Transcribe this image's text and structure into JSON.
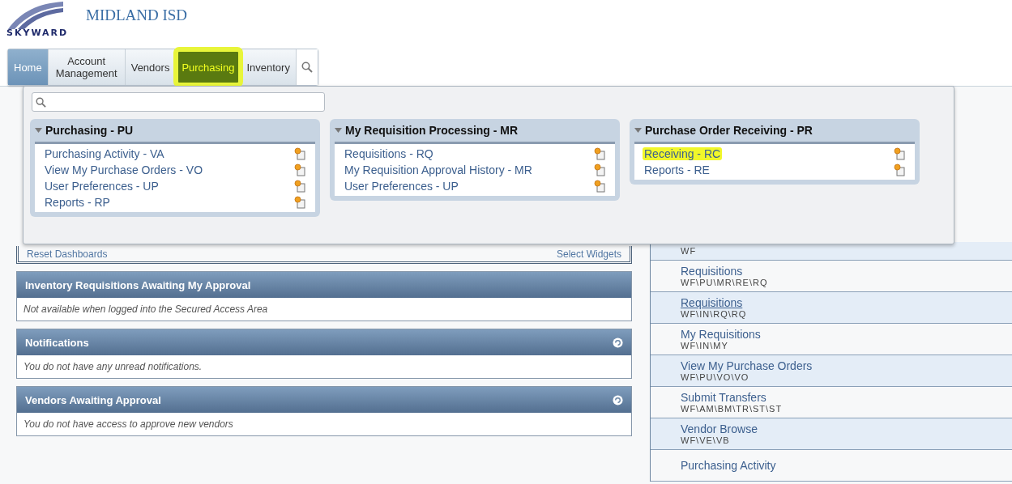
{
  "header": {
    "logo_text": "SKYWARD",
    "district": "MIDLAND ISD"
  },
  "tabs": [
    {
      "label": "Home",
      "selected": true,
      "highlighted": false
    },
    {
      "label": "Account Management",
      "selected": false,
      "highlighted": false
    },
    {
      "label": "Vendors",
      "selected": false,
      "highlighted": false
    },
    {
      "label": "Purchasing",
      "selected": false,
      "highlighted": true
    },
    {
      "label": "Inventory",
      "selected": false,
      "highlighted": false
    }
  ],
  "menu": {
    "groups": [
      {
        "title": "Purchasing - PU",
        "expanded": true,
        "items": [
          {
            "label": "Purchasing Activity - VA",
            "highlighted": false
          },
          {
            "label": "View My Purchase Orders - VO",
            "highlighted": false
          },
          {
            "label": "User Preferences - UP",
            "highlighted": false
          },
          {
            "label": "Reports - RP",
            "highlighted": false
          }
        ]
      },
      {
        "title": "My Requisition Processing - MR",
        "expanded": true,
        "items": [
          {
            "label": "Requisitions - RQ",
            "highlighted": false
          },
          {
            "label": "My Requisition Approval History - MR",
            "highlighted": false
          },
          {
            "label": "User Preferences - UP",
            "highlighted": false
          }
        ]
      },
      {
        "title": "Purchase Order Receiving - PR",
        "expanded": true,
        "items": [
          {
            "label": "Receiving - RC",
            "highlighted": true
          },
          {
            "label": "Reports - RE",
            "highlighted": false
          }
        ]
      }
    ]
  },
  "dashboard": {
    "left_link": "Reset Dashboards",
    "right_link": "Select Widgets"
  },
  "panels": [
    {
      "title": "Inventory Requisitions Awaiting My Approval",
      "message": "Not available when logged into the Secured Access Area",
      "refresh": false
    },
    {
      "title": "Notifications",
      "message": "You do not have any unread notifications.",
      "refresh": true
    },
    {
      "title": "Vendors Awaiting Approval",
      "message": "You do not have access to approve new vendors",
      "refresh": true
    }
  ],
  "shortcuts": [
    {
      "path": "WF",
      "hovered": false
    },
    {
      "title": "Requisitions",
      "path": "WF\\PU\\MR\\RE\\RQ",
      "hovered": false
    },
    {
      "title": "Requisitions",
      "path": "WF\\IN\\RQ\\RQ",
      "hovered": true
    },
    {
      "title": "My Requisitions",
      "path": "WF\\IN\\MY",
      "hovered": false
    },
    {
      "title": "View My Purchase Orders",
      "path": "WF\\PU\\VO\\VO",
      "hovered": false
    },
    {
      "title": "Submit Transfers",
      "path": "WF\\AM\\BM\\TR\\ST\\ST",
      "hovered": false
    },
    {
      "title": "Vendor Browse",
      "path": "WF\\VE\\VB",
      "hovered": false
    },
    {
      "title": "Purchasing Activity",
      "hovered": false
    }
  ]
}
